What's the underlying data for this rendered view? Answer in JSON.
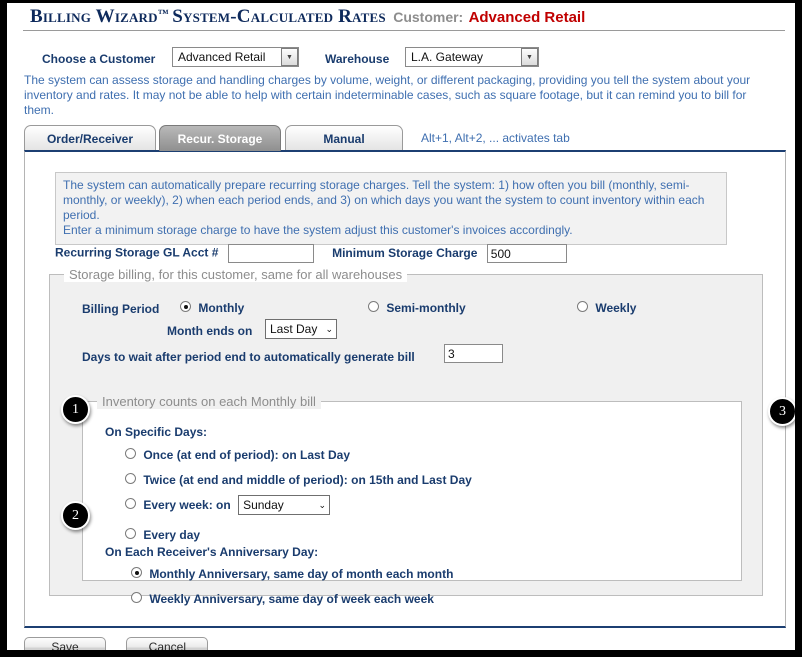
{
  "header": {
    "title_main": "Billing Wizard",
    "title_tm": "™",
    "title_rest": "System-Calculated Rates",
    "customer_label": "Customer:",
    "customer_value": "Advanced Retail"
  },
  "selectors": {
    "customer_label": "Choose a Customer",
    "customer_value": "Advanced Retail",
    "warehouse_label": "Warehouse",
    "warehouse_value": "L.A. Gateway",
    "dropdown_arrow": "▼"
  },
  "intro": "The system can assess storage and handling charges by volume, weight, or different packaging, providing you tell the system about your inventory and rates. It may not be able to help with certain indeterminable cases, such as square footage, but it can remind you to bill for them.",
  "tabs": {
    "items": [
      {
        "label": "Order/Receiver",
        "active": false
      },
      {
        "label": "Recur. Storage",
        "active": true
      },
      {
        "label": "Manual",
        "active": false
      }
    ],
    "hint": "Alt+1, Alt+2, ... activates tab"
  },
  "note": {
    "line1": "The system can automatically prepare recurring storage charges. Tell the system: 1) how often you bill (monthly, semi-monthly, or weekly), 2) when each period ends, and 3) on which days you want the system to count inventory within each period.",
    "line2": "Enter a minimum storage charge to have the system adjust this customer's invoices accordingly."
  },
  "gl_row": {
    "gl_label": "Recurring Storage GL Acct #",
    "gl_value": "",
    "min_label": "Minimum Storage Charge",
    "min_value": "500"
  },
  "storage_fieldset": {
    "legend": "Storage billing, for this customer, same for all warehouses",
    "billing_period_label": "Billing Period",
    "options": [
      {
        "label": "Monthly",
        "checked": true
      },
      {
        "label": "Semi-monthly",
        "checked": false
      },
      {
        "label": "Weekly",
        "checked": false
      }
    ],
    "month_ends_label": "Month ends on",
    "month_ends_value": "Last Day",
    "days_wait_label": "Days to wait after period end to automatically generate bill",
    "days_wait_value": "3"
  },
  "inventory_fieldset": {
    "legend": "Inventory counts on each Monthly bill",
    "specific_days_header": "On Specific Days:",
    "specific_days_options": [
      {
        "label": "Once (at end of period): on Last Day",
        "checked": false
      },
      {
        "label": "Twice (at end and middle of period): on 15th and Last Day",
        "checked": false
      }
    ],
    "every_week_label": "Every week: on",
    "every_week_value": "Sunday",
    "every_week_checked": false,
    "every_day_label": "Every day",
    "every_day_checked": false,
    "anniversary_header": "On Each Receiver's Anniversary Day:",
    "anniversary_options": [
      {
        "label": "Monthly Anniversary, same day of month each month",
        "checked": true
      },
      {
        "label": "Weekly Anniversary, same day of week each week",
        "checked": false
      }
    ],
    "select_caret": "⌄"
  },
  "callouts": [
    {
      "number": "1"
    },
    {
      "number": "2"
    },
    {
      "number": "3"
    }
  ],
  "buttons": {
    "save": "Save",
    "cancel": "Cancel"
  }
}
